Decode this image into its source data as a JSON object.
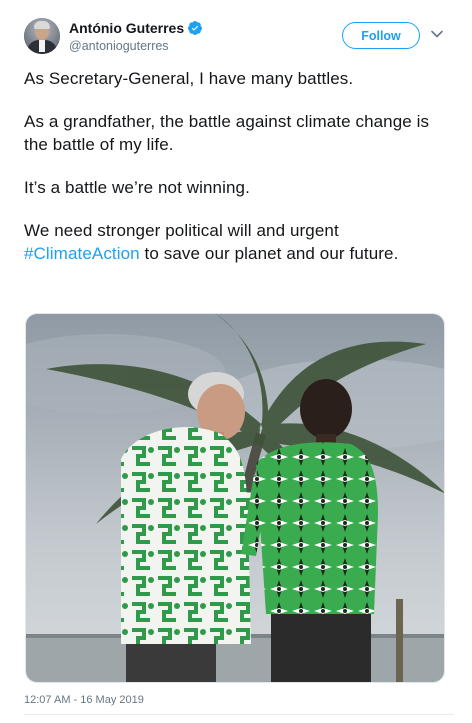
{
  "author": {
    "display_name": "António Guterres",
    "handle": "@antonioguterres"
  },
  "follow_button": {
    "label": "Follow"
  },
  "tweet": {
    "paragraphs": [
      "As Secretary-General, I have many battles.",
      "As a grandfather, the battle against climate change is the battle of my life.",
      "It’s a battle we’re not winning."
    ],
    "last_paragraph": {
      "before": "We need stronger political will and urgent",
      "hashtag": "#ClimateAction",
      "after": " to save our planet and our future."
    }
  },
  "timestamp": "12:07 AM - 16 May 2019",
  "colors": {
    "accent": "#1da1f2",
    "secondary_text": "#657786"
  },
  "icons": {
    "verified": "verified-badge-icon",
    "menu": "chevron-down-icon"
  }
}
